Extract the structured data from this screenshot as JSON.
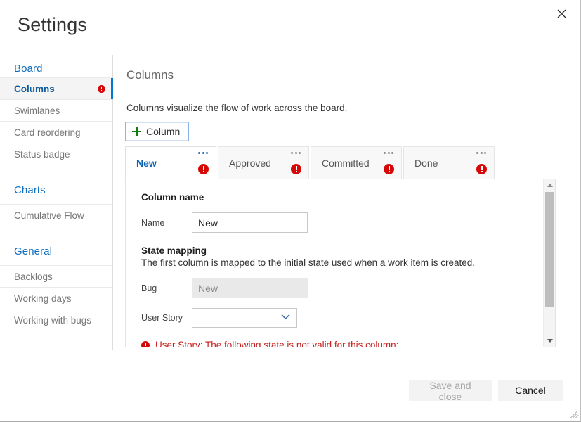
{
  "window": {
    "title": "Settings",
    "close_icon": "close-icon"
  },
  "sidebar": {
    "groups": [
      {
        "title": "Board",
        "items": [
          {
            "label": "Columns",
            "selected": true,
            "has_error": true
          },
          {
            "label": "Swimlanes",
            "selected": false,
            "has_error": false
          },
          {
            "label": "Card reordering",
            "selected": false,
            "has_error": false
          },
          {
            "label": "Status badge",
            "selected": false,
            "has_error": false
          }
        ]
      },
      {
        "title": "Charts",
        "items": [
          {
            "label": "Cumulative Flow",
            "selected": false,
            "has_error": false
          }
        ]
      },
      {
        "title": "General",
        "items": [
          {
            "label": "Backlogs",
            "selected": false,
            "has_error": false
          },
          {
            "label": "Working days",
            "selected": false,
            "has_error": false
          },
          {
            "label": "Working with bugs",
            "selected": false,
            "has_error": false
          }
        ]
      }
    ]
  },
  "main": {
    "heading": "Columns",
    "description": "Columns visualize the flow of work across the board.",
    "add_column_label": "Column",
    "add_column_icon": "plus-icon",
    "tabs": [
      {
        "label": "New",
        "selected": true,
        "has_error": true,
        "menu_icon": "ellipsis-icon"
      },
      {
        "label": "Approved",
        "selected": false,
        "has_error": true,
        "menu_icon": "ellipsis-icon"
      },
      {
        "label": "Committed",
        "selected": false,
        "has_error": true,
        "menu_icon": "ellipsis-icon"
      },
      {
        "label": "Done",
        "selected": false,
        "has_error": true,
        "menu_icon": "ellipsis-icon"
      }
    ],
    "panel": {
      "column_name_title": "Column name",
      "name_label": "Name",
      "name_value": "New",
      "state_mapping_title": "State mapping",
      "state_mapping_desc": "The first column is mapped to the initial state used when a work item is created.",
      "bug_label": "Bug",
      "bug_value": "New",
      "user_story_label": "User Story",
      "user_story_value": "",
      "validation_message": "User Story: The following state is not valid for this column: .",
      "validation_color": "#c5221f"
    },
    "scrollbar": {
      "up_icon": "chevron-up-icon",
      "down_icon": "chevron-down-icon"
    }
  },
  "footer": {
    "save_label": "Save and close",
    "cancel_label": "Cancel"
  },
  "colors": {
    "accent": "#0078d4",
    "link": "#106ebe",
    "error": "#d60707",
    "plus_green": "#107c10"
  }
}
